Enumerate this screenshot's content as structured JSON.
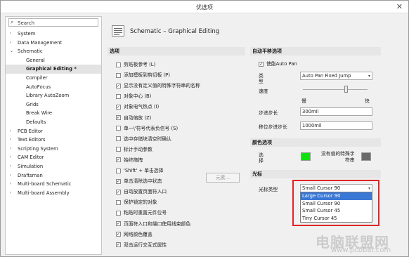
{
  "window": {
    "title": "优选项"
  },
  "search": {
    "placeholder": "Search",
    "value": "Search"
  },
  "tree": [
    {
      "label": "System",
      "arrow": "›",
      "child": false,
      "selected": false
    },
    {
      "label": "Data Management",
      "arrow": "›",
      "child": false,
      "selected": false
    },
    {
      "label": "Schematic",
      "arrow": "⌄",
      "child": false,
      "selected": false
    },
    {
      "label": "General",
      "arrow": "",
      "child": true,
      "selected": false
    },
    {
      "label": "Graphical Editing *",
      "arrow": "",
      "child": true,
      "selected": true
    },
    {
      "label": "Compiler",
      "arrow": "",
      "child": true,
      "selected": false
    },
    {
      "label": "AutoFocus",
      "arrow": "",
      "child": true,
      "selected": false
    },
    {
      "label": "Library AutoZoom",
      "arrow": "",
      "child": true,
      "selected": false
    },
    {
      "label": "Grids",
      "arrow": "",
      "child": true,
      "selected": false
    },
    {
      "label": "Break Wire",
      "arrow": "",
      "child": true,
      "selected": false
    },
    {
      "label": "Defaults",
      "arrow": "",
      "child": true,
      "selected": false
    },
    {
      "label": "PCB Editor",
      "arrow": "›",
      "child": false,
      "selected": false
    },
    {
      "label": "Text Editors",
      "arrow": "›",
      "child": false,
      "selected": false
    },
    {
      "label": "Scripting System",
      "arrow": "›",
      "child": false,
      "selected": false
    },
    {
      "label": "CAM Editor",
      "arrow": "›",
      "child": false,
      "selected": false
    },
    {
      "label": "Simulation",
      "arrow": "›",
      "child": false,
      "selected": false
    },
    {
      "label": "Draftsman",
      "arrow": "›",
      "child": false,
      "selected": false
    },
    {
      "label": "Multi-board Schematic",
      "arrow": "›",
      "child": false,
      "selected": false
    },
    {
      "label": "Multi-board Assembly",
      "arrow": "›",
      "child": false,
      "selected": false
    }
  ],
  "header": {
    "title": "Schematic – Graphical Editing",
    "icon": "schematic-page-icon"
  },
  "options": {
    "section": "选项",
    "items": [
      {
        "label": "剪贴板参考 (L)",
        "checked": false
      },
      {
        "label": "添加模板到剪切板 (P)",
        "checked": false
      },
      {
        "label": "显示没有定义值的特殊字符串的名称",
        "checked": true
      },
      {
        "label": "对象中心 (B)",
        "checked": false
      },
      {
        "label": "对象电气热点 (I)",
        "checked": true
      },
      {
        "label": "自动缩放 (Z)",
        "checked": true
      },
      {
        "label": "单一\\'符号代表负信号 (S)",
        "checked": false
      },
      {
        "label": "选中存储块清空时确认",
        "checked": false
      },
      {
        "label": "标计手动参数",
        "checked": false
      },
      {
        "label": "始终拖拽",
        "checked": true
      },
      {
        "label": "'Shift' + 单击选择",
        "checked": false
      },
      {
        "label": "单击清除选中状态",
        "checked": true
      },
      {
        "label": "自动放置页面符入口",
        "checked": true
      },
      {
        "label": "保护锁定的对象",
        "checked": false
      },
      {
        "label": "粘贴时重置元件位号",
        "checked": false
      },
      {
        "label": "页面符入口和端口使用线束颜色",
        "checked": true
      },
      {
        "label": "网络颜色覆盖",
        "checked": true
      },
      {
        "label": "双击运行交互式属性",
        "checked": true
      }
    ],
    "elements_button": "元素..."
  },
  "autopan": {
    "section": "自动平移选项",
    "enable_label": "使能Auto Pan",
    "enable_checked": true,
    "type_label": "类\n型",
    "type_value": "Auto Pan Fixed Jump",
    "speed_label": "速度",
    "slow_label": "慢",
    "fast_label": "快",
    "speed_level": 0.66,
    "step_label": "步进步长",
    "step_value": "300mil",
    "shift_step_label": "移位步进步长",
    "shift_step_value": "1000mil"
  },
  "colors": {
    "section": "颜色选项",
    "select_label": "选\n择",
    "select_color": "#10e010",
    "undefined_label": "没有值的特殊字\n符串",
    "undefined_color": "#6a6a6a"
  },
  "cursor": {
    "section": "光标",
    "type_label": "光标类型",
    "value": "Small Cursor 90",
    "options": [
      "Large Cursor 90",
      "Small Cursor 90",
      "Small Cursor 45",
      "Tiny Cursor 45"
    ],
    "highlighted": "Large Cursor 90"
  },
  "watermark": {
    "main": "电脑联盟网",
    "url": "www.pcbbar.com"
  }
}
